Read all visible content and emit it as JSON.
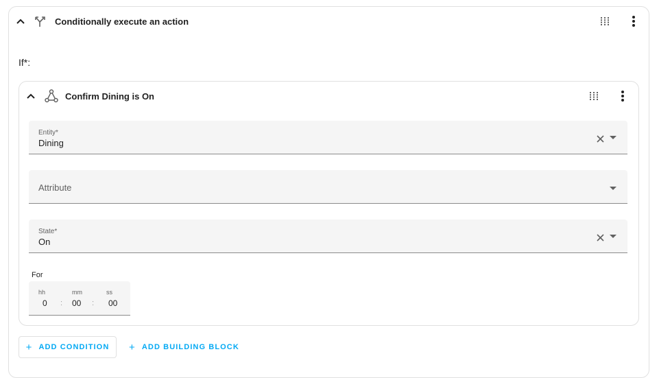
{
  "action": {
    "title": "Conditionally execute an action",
    "icons": {
      "collapse": "chevron-up-icon",
      "type": "call-split-icon",
      "drag": "drag-handle-icon",
      "menu": "dots-vertical-icon"
    }
  },
  "if_section": {
    "label": "If*:"
  },
  "condition": {
    "title": "Confirm Dining is On",
    "icons": {
      "collapse": "chevron-up-icon",
      "type": "state-graph-icon",
      "drag": "drag-handle-icon",
      "menu": "dots-vertical-icon"
    },
    "entity": {
      "label": "Entity*",
      "value": "Dining"
    },
    "attribute": {
      "placeholder": "Attribute"
    },
    "state": {
      "label": "State*",
      "value": "On"
    },
    "for": {
      "label": "For",
      "hh_label": "hh",
      "hh_value": "0",
      "mm_label": "mm",
      "mm_value": "00",
      "ss_label": "ss",
      "ss_value": "00",
      "separator": ":"
    }
  },
  "buttons": {
    "add_condition": {
      "icon": "+",
      "label": "Add condition"
    },
    "add_building_block": {
      "icon": "+",
      "label": "Add building block"
    }
  },
  "colors": {
    "accent": "#03a9f4",
    "field_bg": "#f5f5f5",
    "border": "#e0e0e0"
  }
}
